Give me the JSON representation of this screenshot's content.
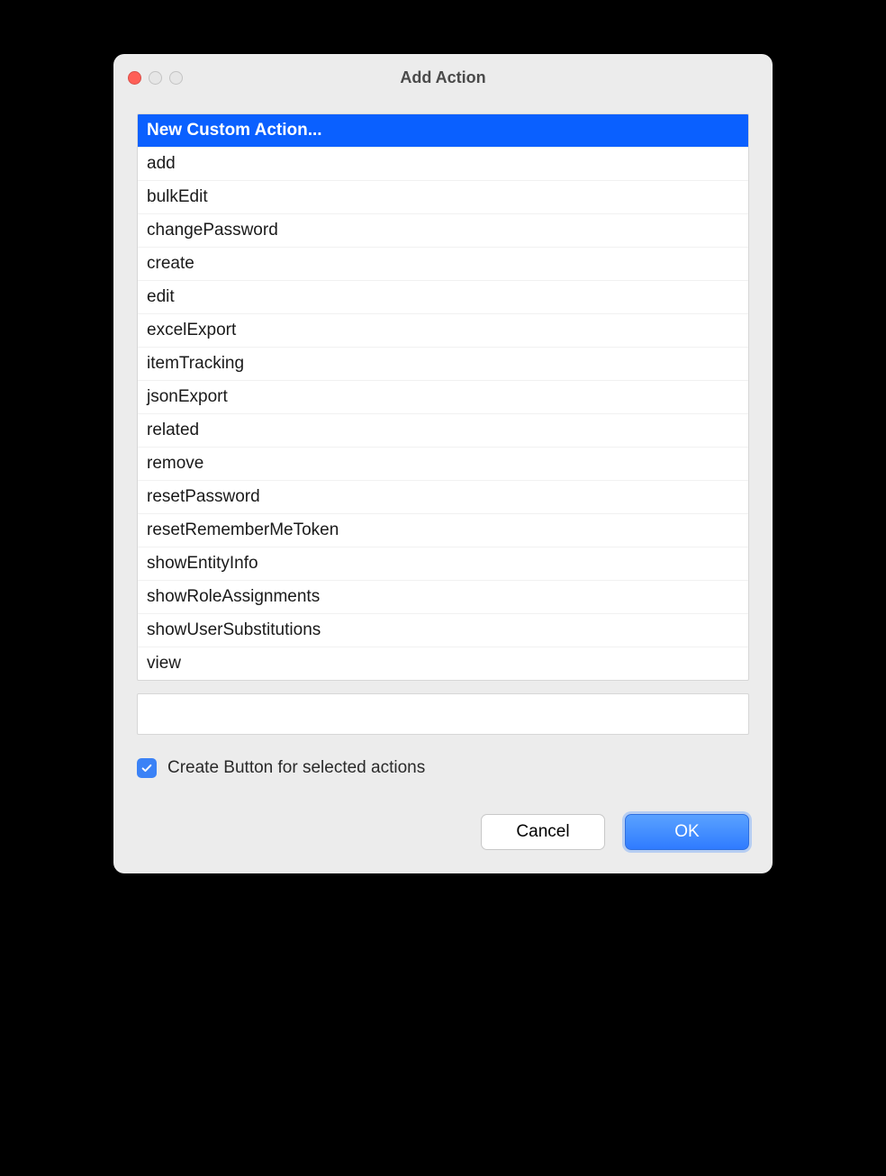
{
  "dialog": {
    "title": "Add Action"
  },
  "list": {
    "selectedIndex": 0,
    "items": [
      "New Custom Action...",
      "add",
      "bulkEdit",
      "changePassword",
      "create",
      "edit",
      "excelExport",
      "itemTracking",
      "jsonExport",
      "related",
      "remove",
      "resetPassword",
      "resetRememberMeToken",
      "showEntityInfo",
      "showRoleAssignments",
      "showUserSubstitutions",
      "view"
    ]
  },
  "filter": {
    "value": ""
  },
  "checkbox": {
    "checked": true,
    "label": "Create Button for selected actions"
  },
  "buttons": {
    "cancel": "Cancel",
    "ok": "OK"
  }
}
